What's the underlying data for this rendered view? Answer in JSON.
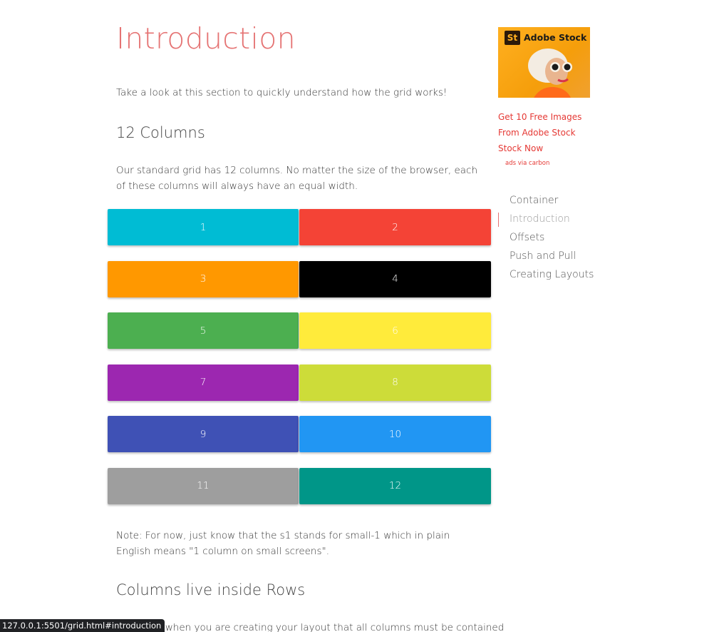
{
  "content": {
    "title": "Introduction",
    "intro": "Take a look at this section to quickly understand how the grid works!",
    "columns_heading": "12 Columns",
    "columns_paragraph": "Our standard grid has 12 columns. No matter the size of the browser, each of these columns will always have an equal width.",
    "grid_cells": [
      {
        "label": "1",
        "color": "#00bcd4"
      },
      {
        "label": "2",
        "color": "#f44336"
      },
      {
        "label": "3",
        "color": "#ff9800"
      },
      {
        "label": "4",
        "color": "#000000"
      },
      {
        "label": "5",
        "color": "#4caf50"
      },
      {
        "label": "6",
        "color": "#ffeb3b"
      },
      {
        "label": "7",
        "color": "#9c27b0"
      },
      {
        "label": "8",
        "color": "#cddc39"
      },
      {
        "label": "9",
        "color": "#3f51b5"
      },
      {
        "label": "10",
        "color": "#2196f3"
      },
      {
        "label": "11",
        "color": "#9e9e9e"
      },
      {
        "label": "12",
        "color": "#009688"
      }
    ],
    "note": "Note: For now, just know that the s1 stands for small-1 which in plain English means \"1 column on small screens\".",
    "rows_heading": "Columns live inside Rows",
    "rows_paragraph_partial": "ber when you are creating your layout that all columns must be contained"
  },
  "sidebar": {
    "ad_brand": "Adobe Stock",
    "ad_logo": "St",
    "ad_link": "Get 10 Free Images From Adobe Stock Stock Now",
    "ad_via": "ads via carbon",
    "toc": [
      {
        "label": "Container",
        "active": false
      },
      {
        "label": "Introduction",
        "active": true
      },
      {
        "label": "Offsets",
        "active": false
      },
      {
        "label": "Push and Pull",
        "active": false
      },
      {
        "label": "Creating Layouts",
        "active": false
      }
    ]
  },
  "status_bar": {
    "url": "127.0.0.1:5501/grid.html#introduction"
  }
}
